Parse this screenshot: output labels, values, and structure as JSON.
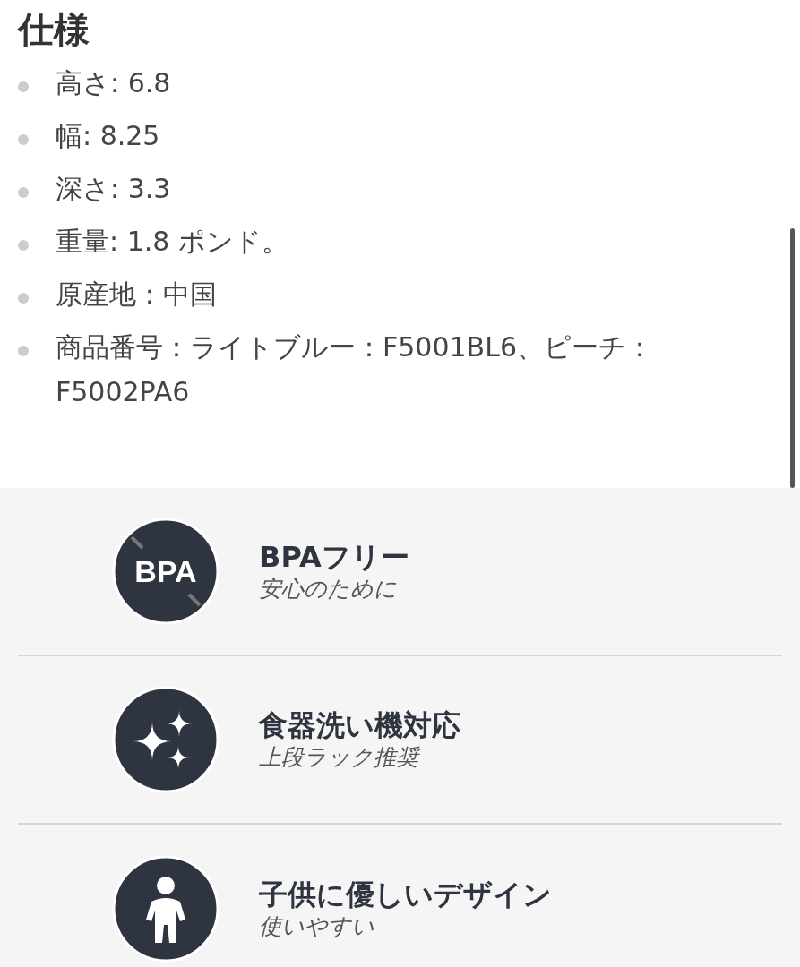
{
  "specs": {
    "title": "仕様",
    "items": [
      "高さ: 6.8",
      "幅: 8.25",
      "深さ: 3.3",
      "重量: 1.8 ポンド。",
      "原産地：中国",
      "商品番号：ライトブルー：F5001BL6、ピーチ：F5002PA6"
    ]
  },
  "features": [
    {
      "kind": "bpa",
      "icon_text": "BPA",
      "title": "BPAフリー",
      "subtitle": "安心のために"
    },
    {
      "kind": "sparkle",
      "title": "食器洗い機対応",
      "subtitle": "上段ラック推奨"
    },
    {
      "kind": "child",
      "title": "子供に優しいデザイン",
      "subtitle": "使いやすい"
    }
  ]
}
